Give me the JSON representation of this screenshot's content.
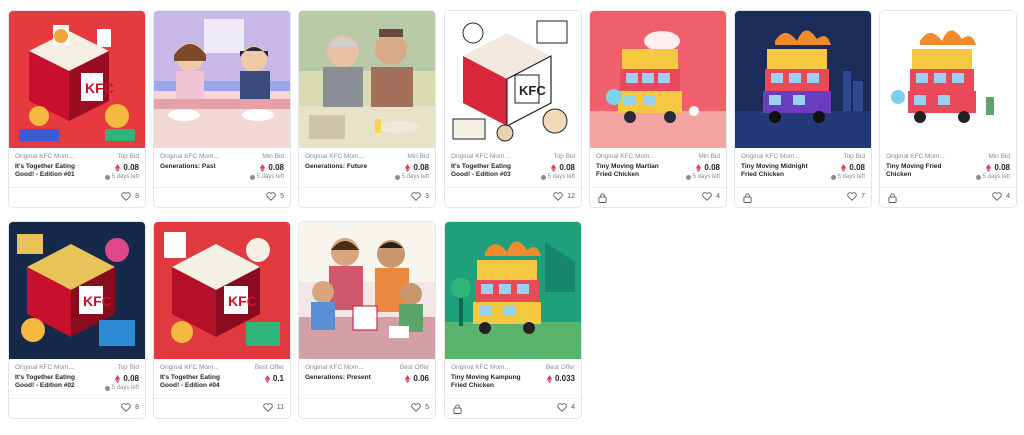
{
  "cards": [
    {
      "collection": "Original KFC Mom...",
      "bid_type": "Top Bid",
      "title": "It's Together Eating Good! - Edition #01",
      "price": "0.08",
      "time_left": "5 days left",
      "likes": "8",
      "locked": false,
      "art": "red-isometric-kfc"
    },
    {
      "collection": "Original KFC Mom...",
      "bid_type": "Min Bid",
      "title": "Generations: Past",
      "price": "0.08",
      "time_left": "5 days left",
      "likes": "5",
      "locked": false,
      "art": "family-past"
    },
    {
      "collection": "Original KFC Mom...",
      "bid_type": "Min Bid",
      "title": "Generations: Future",
      "price": "0.08",
      "time_left": "5 days left",
      "likes": "3",
      "locked": false,
      "art": "elderly-couple"
    },
    {
      "collection": "Original KFC Mom...",
      "bid_type": "Top Bid",
      "title": "It's Together Eating Good! - Edition #03",
      "price": "0.08",
      "time_left": "5 days left",
      "likes": "12",
      "locked": false,
      "art": "white-isometric-kfc"
    },
    {
      "collection": "Original KFC Mom...",
      "bid_type": "Min Bid",
      "title": "Tiny Moving Martian Fried Chicken",
      "price": "0.08",
      "time_left": "5 days left",
      "likes": "4",
      "locked": true,
      "art": "bus-pink"
    },
    {
      "collection": "Original KFC Mom...",
      "bid_type": "Top Bid",
      "title": "Tiny Moving Midnight Fried Chicken",
      "price": "0.08",
      "time_left": "5 days left",
      "likes": "7",
      "locked": true,
      "art": "bus-navy"
    },
    {
      "collection": "Original KFC Mom...",
      "bid_type": "Min Bid",
      "title": "Tiny Moving Fried Chicken",
      "price": "0.08",
      "time_left": "5 days left",
      "likes": "4",
      "locked": true,
      "art": "bus-white"
    },
    {
      "collection": "Original KFC Mom...",
      "bid_type": "Top Bid",
      "title": "It's Together Eating Good! - Edition #02",
      "price": "0.08",
      "time_left": "5 days left",
      "likes": "8",
      "locked": false,
      "art": "dark-isometric-kfc"
    },
    {
      "collection": "Original KFC Mom...",
      "bid_type": "Best Offer",
      "title": "It's Together Eating Good! - Edition #04",
      "price": "0.1",
      "time_left": "",
      "likes": "11",
      "locked": false,
      "art": "red-isometric-kfc-2"
    },
    {
      "collection": "Original KFC Mom...",
      "bid_type": "Best Offer",
      "title": "Generations: Present",
      "price": "0.06",
      "time_left": "",
      "likes": "5",
      "locked": false,
      "art": "family-present"
    },
    {
      "collection": "Original KFC Mom...",
      "bid_type": "Best Offer",
      "title": "Tiny Moving Kampung Fried Chicken",
      "price": "0.033",
      "time_left": "",
      "likes": "4",
      "locked": true,
      "art": "bus-green"
    }
  ],
  "colors": {
    "eth_red": "#e8394d",
    "border": "#e4e6ee",
    "muted_text": "#8a8d99"
  }
}
